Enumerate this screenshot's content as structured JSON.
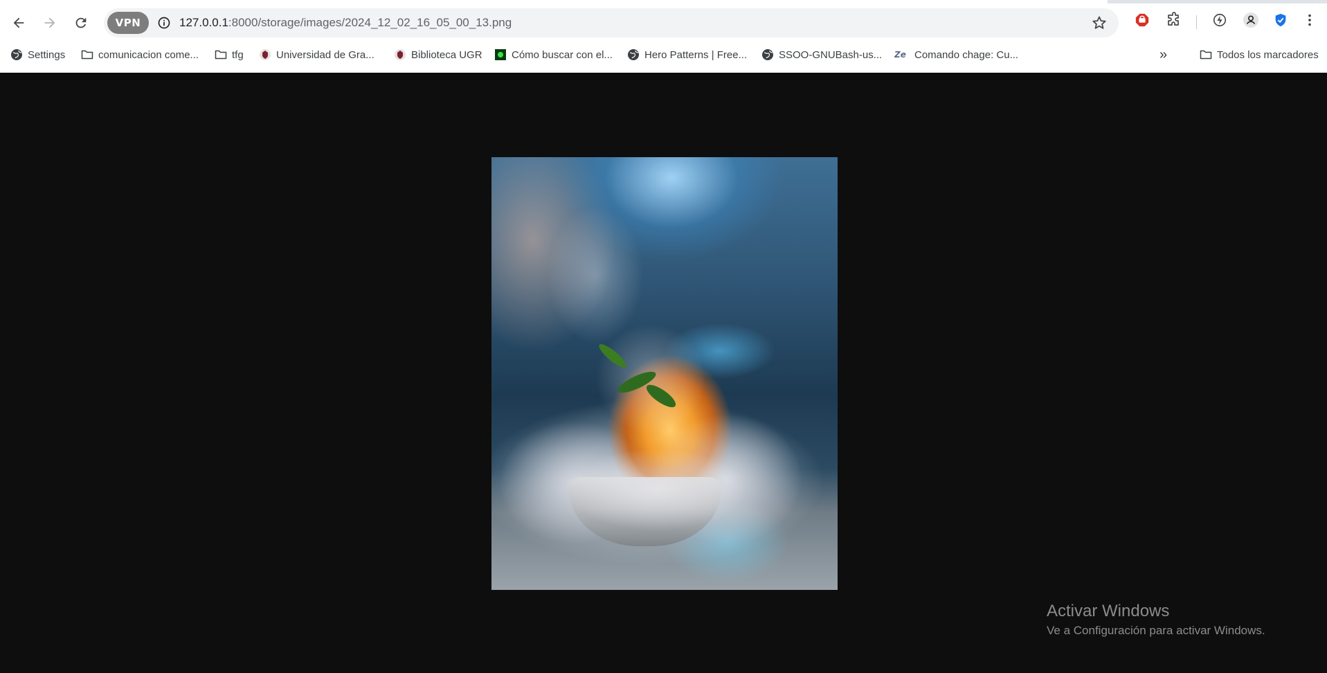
{
  "browser": {
    "vpn_label": "VPN",
    "url_host": "127.0.0.1",
    "url_path": ":8000/storage/images/2024_12_02_16_05_00_13.png"
  },
  "bookmarks": {
    "items": [
      {
        "label": "Settings",
        "icon": "globe-icon"
      },
      {
        "label": "comunicacion come...",
        "icon": "folder-icon"
      },
      {
        "label": "tfg",
        "icon": "folder-icon"
      },
      {
        "label": "Universidad de Gra...",
        "icon": "crest-icon"
      },
      {
        "label": "Biblioteca UGR",
        "icon": "crest-icon"
      },
      {
        "label": "Cómo buscar con el...",
        "icon": "green-square-icon"
      },
      {
        "label": "Hero Patterns | Free...",
        "icon": "globe-icon"
      },
      {
        "label": "SSOO-GNUBash-us...",
        "icon": "globe-icon"
      },
      {
        "label": "Comando chage: Cu...",
        "icon": "ze-icon"
      }
    ],
    "overflow_label": "»",
    "all_bookmarks_label": "Todos los marcadores"
  },
  "viewer": {
    "image_description": "dessert image"
  },
  "watermark": {
    "title": "Activar Windows",
    "subtitle": "Ve a Configuración para activar Windows."
  },
  "colors": {
    "page_background": "#0e0e0e",
    "chrome_background": "#ffffff",
    "omnibox_background": "#f1f3f4",
    "vpn_chip": "#7d7d7d",
    "adblock_red": "#d93025",
    "shield_blue": "#1a73e8"
  }
}
